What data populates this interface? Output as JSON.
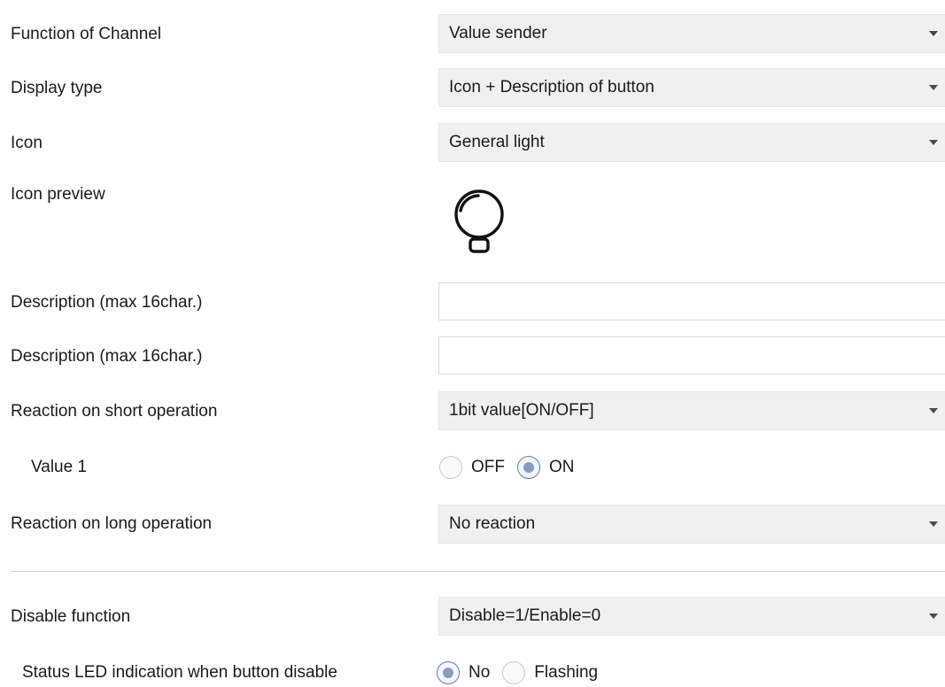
{
  "rows": {
    "function_of_channel": {
      "label": "Function of Channel",
      "value": "Value sender"
    },
    "display_type": {
      "label": "Display type",
      "value": "Icon + Description of button"
    },
    "icon": {
      "label": "Icon",
      "value": "General light"
    },
    "icon_preview": {
      "label": "Icon preview",
      "icon": "lightbulb-icon"
    },
    "description_1": {
      "label": "Description (max 16char.)",
      "value": ""
    },
    "description_2": {
      "label": "Description (max 16char.)",
      "value": ""
    },
    "reaction_short": {
      "label": "Reaction on short operation",
      "value": "1bit value[ON/OFF]"
    },
    "value_1": {
      "label": "Value 1",
      "options": [
        "OFF",
        "ON"
      ],
      "selected": "ON"
    },
    "reaction_long": {
      "label": "Reaction on long operation",
      "value": "No reaction"
    },
    "disable_function": {
      "label": "Disable function",
      "value": "Disable=1/Enable=0"
    },
    "status_led": {
      "label": "Status LED indication when button disable",
      "options": [
        "No",
        "Flashing"
      ],
      "selected": "No"
    }
  },
  "colors": {
    "dropdown_bg": "#f0f0f0",
    "radio_selected": "#7f9fc9",
    "divider": "#cfcfcf"
  }
}
